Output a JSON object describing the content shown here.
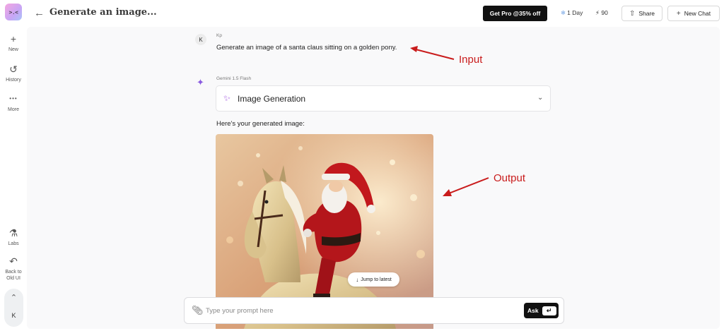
{
  "app": {
    "logo_face": ">.<",
    "page_title": "Generate an image..."
  },
  "sidebar": {
    "items": [
      {
        "icon": "plus-icon",
        "glyph": "+",
        "label": "New"
      },
      {
        "icon": "history-icon",
        "glyph": "↺",
        "label": "History"
      },
      {
        "icon": "more-icon",
        "glyph": "•••",
        "label": "More"
      },
      {
        "icon": "flask-icon",
        "glyph": "⚗",
        "label": "Labs"
      },
      {
        "icon": "undo-icon",
        "glyph": "↶",
        "label": "Back to Old UI"
      }
    ],
    "profile": {
      "chevron": "⌃",
      "initial": "K"
    }
  },
  "topbar": {
    "pro_label": "Get Pro @35% off",
    "day_label": "1 Day",
    "credits": "90",
    "share_label": "Share",
    "new_chat_label": "New Chat"
  },
  "chat": {
    "user": {
      "avatar_initial": "K",
      "name": "Kp",
      "message": "Generate an image of a santa claus sitting on a golden pony."
    },
    "assistant": {
      "model": "Gemini 1.5 Flash",
      "tool_label": "Image Generation",
      "intro": "Here's your generated image:"
    }
  },
  "annotations": {
    "input_label": "Input",
    "output_label": "Output",
    "color": "#c91c1c"
  },
  "jump_label": "Jump to latest",
  "composer": {
    "placeholder": "Type your prompt here",
    "ask_label": "Ask"
  },
  "colors": {
    "pro_button": "#111111",
    "accent_purple": "#8a5be0",
    "panel_bg": "#f9f9fa"
  }
}
